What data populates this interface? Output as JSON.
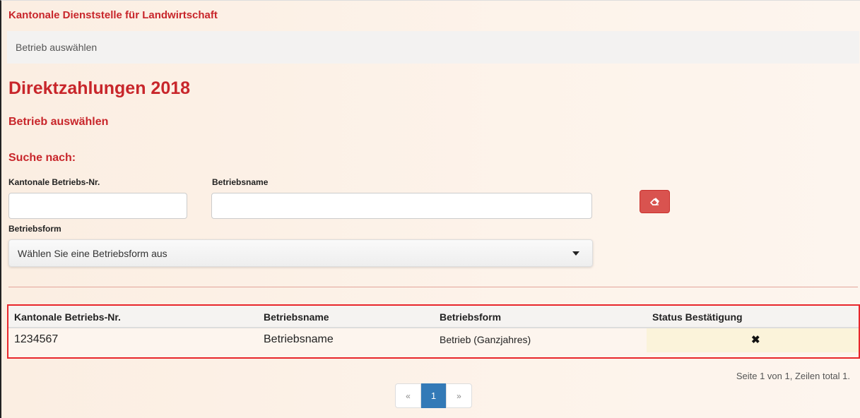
{
  "app": {
    "title": "Kantonale Dienststelle für Landwirtschaft"
  },
  "breadcrumb": {
    "text": "Betrieb auswählen"
  },
  "page": {
    "title": "Direktzahlungen 2018",
    "section": "Betrieb auswählen",
    "search_heading": "Suche nach:"
  },
  "form": {
    "betriebs_nr_label": "Kantonale Betriebs-Nr.",
    "betriebs_nr_value": "",
    "betriebsname_label": "Betriebsname",
    "betriebsname_value": "",
    "betriebsform_label": "Betriebsform",
    "betriebsform_selected": "Wählen Sie eine Betriebsform aus",
    "clear_icon": "eraser-icon",
    "clear_button_color": "#d9534f"
  },
  "table": {
    "headers": [
      "Kantonale Betriebs-Nr.",
      "Betriebsname",
      "Betriebsform",
      "Status Bestätigung"
    ],
    "rows": [
      {
        "betriebs_nr": "1234567",
        "betriebsname": "Betriebsname",
        "betriebsform": "Betrieb (Ganzjahres)",
        "status": "✖",
        "status_icon": "x-icon"
      }
    ],
    "highlight_color": "#e8262b"
  },
  "pagination": {
    "info": "Seite 1 von 1, Zeilen total 1.",
    "prev": "«",
    "current": "1",
    "next": "»",
    "active_color": "#337ab7"
  },
  "colors": {
    "accent": "#c8262b"
  }
}
